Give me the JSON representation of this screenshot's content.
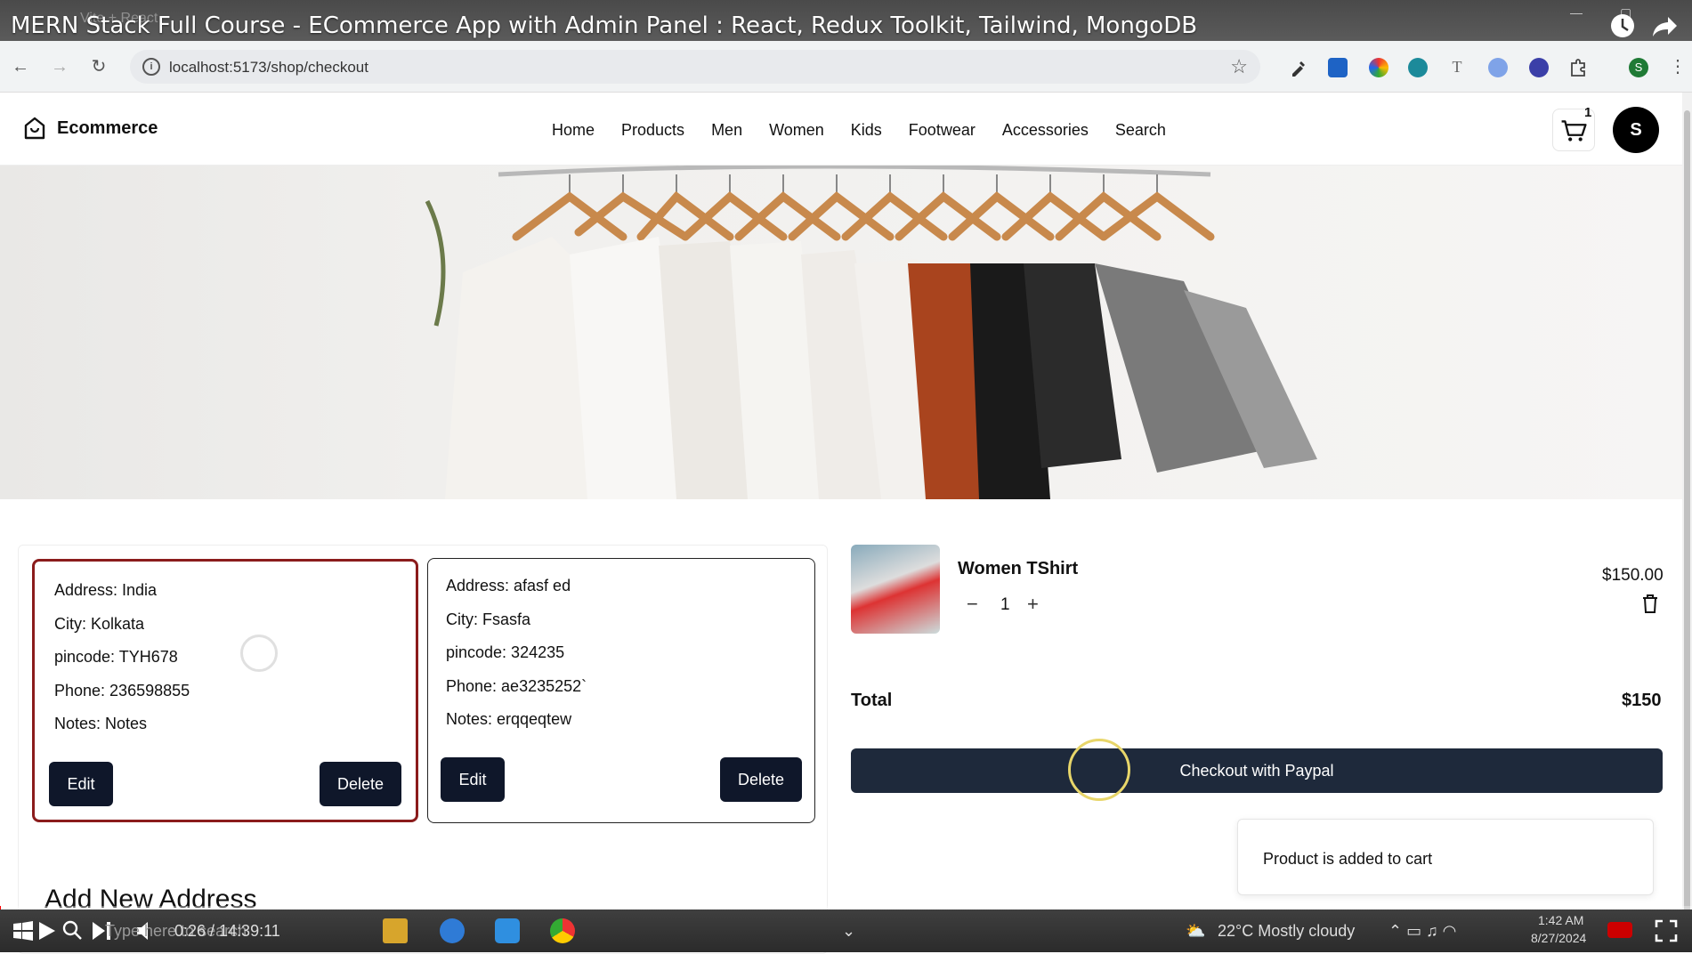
{
  "video": {
    "title": "MERN Stack Full Course - ECommerce App with Admin Panel : React, Redux Toolkit, Tailwind, MongoDB",
    "tab_hint": "Vite + React",
    "time": "0:26 / 14:39:11",
    "progress_fraction": 0.0005
  },
  "browser": {
    "url": "localhost:5173/shop/checkout",
    "avatar_letter": "S"
  },
  "header": {
    "brand": "Ecommerce",
    "menu": [
      "Home",
      "Products",
      "Men",
      "Women",
      "Kids",
      "Footwear",
      "Accessories",
      "Search"
    ],
    "cart_count": "1",
    "avatar_letter": "S"
  },
  "addresses": [
    {
      "address": "Address: India",
      "city": "City: Kolkata",
      "pincode": "pincode: TYH678",
      "phone": "Phone: 236598855",
      "notes": "Notes: Notes",
      "edit": "Edit",
      "delete": "Delete",
      "selected": true
    },
    {
      "address": "Address: afasf ed",
      "city": "City: Fsasfa",
      "pincode": "pincode: 324235",
      "phone": "Phone: ae3235252`",
      "notes": "Notes: erqqeqtew",
      "edit": "Edit",
      "delete": "Delete",
      "selected": false
    }
  ],
  "add_address_title": "Add New Address",
  "cart": {
    "item_name": "Women TShirt",
    "quantity": "1",
    "minus": "−",
    "plus": "+",
    "price": "$150.00",
    "total_label": "Total",
    "total_value": "$150",
    "checkout_label": "Checkout with Paypal"
  },
  "toast": "Product is added to cart",
  "taskbar": {
    "search_hint": "Type here to search",
    "weather": "22°C  Mostly cloudy",
    "clock_time": "1:42 AM",
    "clock_date": "8/27/2024"
  },
  "colors": {
    "selected_border": "#8b1c1c",
    "button_dark": "#0f172a",
    "checkout_bg": "#1e293b"
  }
}
